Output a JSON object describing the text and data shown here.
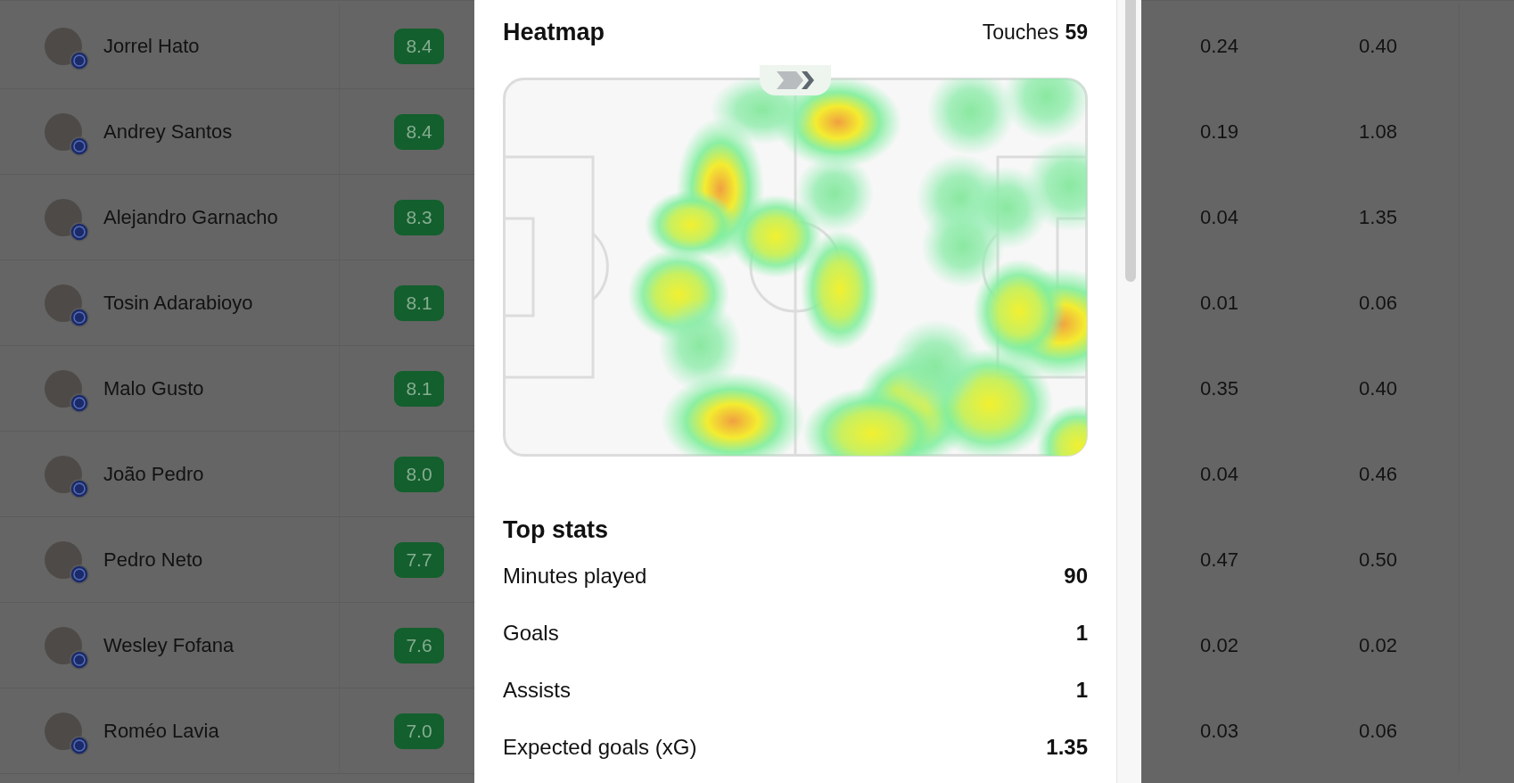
{
  "players": [
    {
      "name": "Jorrel Hato",
      "rating": "8.4",
      "column_3": "0.24",
      "column_4": "0.40"
    },
    {
      "name": "Andrey Santos",
      "rating": "8.4",
      "column_3": "0.19",
      "column_4": "1.08"
    },
    {
      "name": "Alejandro Garnacho",
      "rating": "8.3",
      "column_3": "0.04",
      "column_4": "1.35"
    },
    {
      "name": "Tosin Adarabioyo",
      "rating": "8.1",
      "column_3": "0.01",
      "column_4": "0.06"
    },
    {
      "name": "Malo Gusto",
      "rating": "8.1",
      "column_3": "0.35",
      "column_4": "0.40"
    },
    {
      "name": "João Pedro",
      "rating": "8.0",
      "column_3": "0.04",
      "column_4": "0.46"
    },
    {
      "name": "Pedro Neto",
      "rating": "7.7",
      "column_3": "0.47",
      "column_4": "0.50"
    },
    {
      "name": "Wesley Fofana",
      "rating": "7.6",
      "column_3": "0.02",
      "column_4": "0.02"
    },
    {
      "name": "Roméo Lavia",
      "rating": "7.0",
      "column_3": "0.03",
      "column_4": "0.06"
    }
  ],
  "heatmap": {
    "title": "Heatmap",
    "touches_label": "Touches",
    "touches_value": "59"
  },
  "top_stats": {
    "title": "Top stats",
    "rows": [
      {
        "label": "Minutes played",
        "value": "90"
      },
      {
        "label": "Goals",
        "value": "1"
      },
      {
        "label": "Assists",
        "value": "1"
      },
      {
        "label": "Expected goals (xG)",
        "value": "1.35"
      }
    ]
  }
}
